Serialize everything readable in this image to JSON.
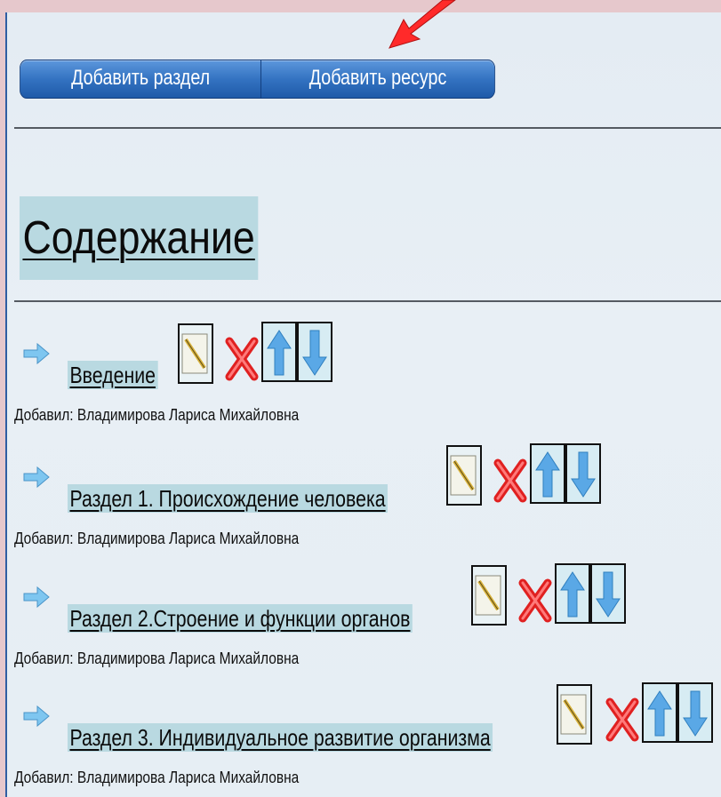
{
  "toolbar": {
    "add_section_label": "Добавить раздел",
    "add_resource_label": "Добавить ресурс"
  },
  "content": {
    "title": "Содержание",
    "items": [
      {
        "title": "Введение",
        "author": "Добавил: Владимирова Лариса Михайловна"
      },
      {
        "title": "Раздел 1. Происхождение человека",
        "author": "Добавил: Владимирова Лариса Михайловна"
      },
      {
        "title": "Раздел 2.Строение и функции органов",
        "author": "Добавил: Владимирова Лариса Михайловна"
      },
      {
        "title": "Раздел 3. Индивидуальное развитие организма",
        "author": "Добавил: Владимирова Лариса Михайловна"
      }
    ]
  },
  "icons": {
    "item_bullet": "right-arrow-icon",
    "edit": "edit-note-icon",
    "delete": "delete-x-icon",
    "move_up": "arrow-up-icon",
    "move_down": "arrow-down-icon",
    "pointer": "red-pointer-arrow-icon"
  },
  "colors": {
    "frame": "#e6c8cc",
    "panel": "#e6eef4",
    "button": "#3473c2",
    "link_highlight": "#b9d9e1",
    "delete": "#e02020",
    "arrow": "#5aa8e6"
  }
}
